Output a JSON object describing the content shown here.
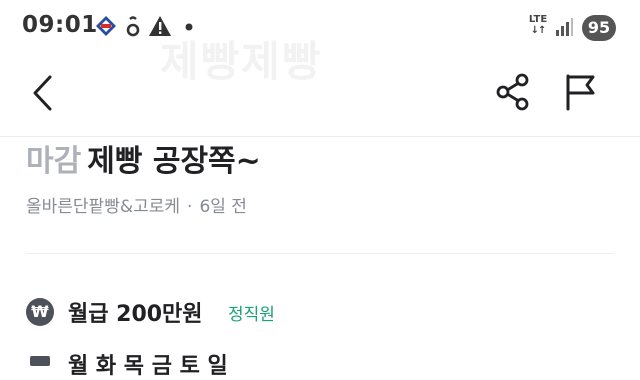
{
  "status_bar": {
    "time": "09:01",
    "network": "LTE",
    "battery": "95"
  },
  "background_watermark": "제빵제빵",
  "post": {
    "status_label": "마감",
    "title": "제빵 공장쪽~",
    "store_name": "올바른단팥빵&고로케",
    "separator": "·",
    "posted_ago": "6일 전"
  },
  "details": {
    "salary": "월급 200만원",
    "employment_type": "정직원",
    "next_row_partial": "월 화 목 금 토 일"
  },
  "icons": {
    "back": "back-chevron-icon",
    "share": "share-icon",
    "report": "flag-icon",
    "salary": "won-icon"
  },
  "colors": {
    "accent_green": "#1aa174",
    "status_gray": "#adb1ba",
    "meta_gray": "#868b94",
    "text": "#212124"
  }
}
